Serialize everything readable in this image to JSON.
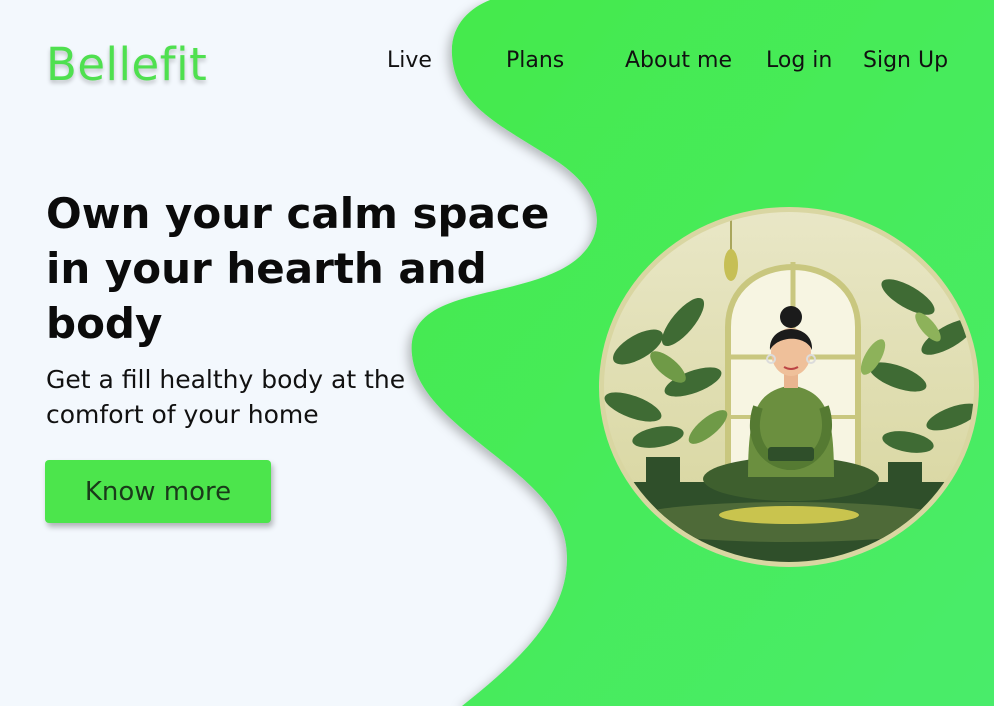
{
  "brand": {
    "logo_text": "Bellefit",
    "accent_color": "#4fe04f"
  },
  "nav": {
    "items": [
      {
        "label": "Live"
      },
      {
        "label": "Plans"
      },
      {
        "label": "About me"
      },
      {
        "label": "Log in"
      },
      {
        "label": "Sign Up"
      }
    ]
  },
  "hero": {
    "title": "Own your calm space in your hearth and body",
    "subtitle": "Get a fill healthy body at the comfort of your home",
    "cta_label": "Know more"
  },
  "illustration": {
    "icon": "meditating-woman-illustration"
  },
  "colors": {
    "background": "#f3f8fd",
    "blob_green": "#45e84f",
    "button_green": "#4ce54c"
  }
}
